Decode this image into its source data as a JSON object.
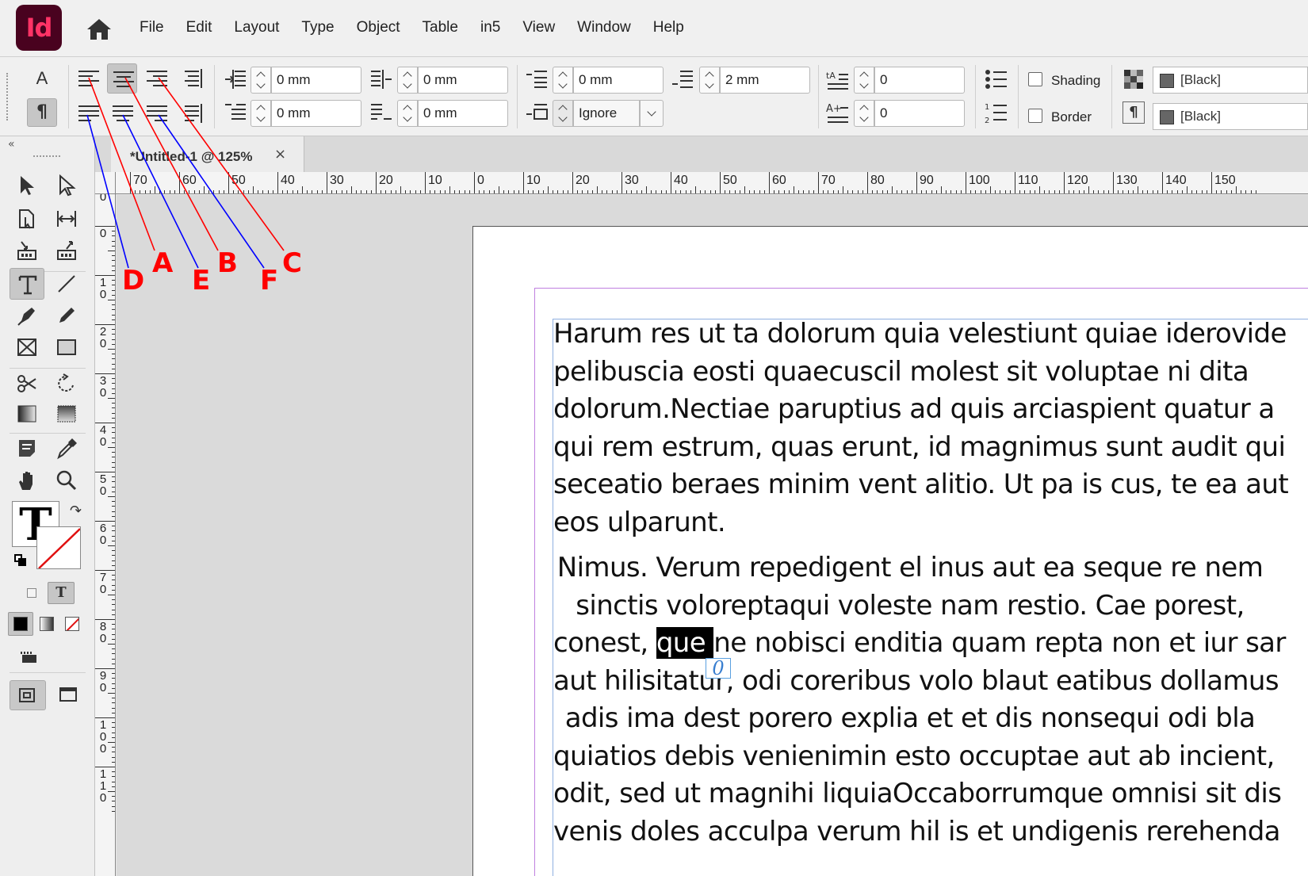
{
  "app": {
    "logo_text": "Id",
    "brand_color": "#49021f",
    "accent_color": "#ff3366"
  },
  "menu": [
    "File",
    "Edit",
    "Layout",
    "Type",
    "Object",
    "Table",
    "in5",
    "View",
    "Window",
    "Help"
  ],
  "control": {
    "left_indent": "0 mm",
    "right_indent": "0 mm",
    "first_line_indent": "0 mm",
    "last_line_indent": "0 mm",
    "space_before": "0 mm",
    "space_after": "2 mm",
    "align_to_grid": "Ignore",
    "drop_cap_lines": "0",
    "drop_cap_chars": "0",
    "shading_label": "Shading",
    "border_label": "Border",
    "shading_color": "[Black]",
    "border_color": "[Black]"
  },
  "tab": {
    "title": "*Untitled-1 @ 125%",
    "close": "×"
  },
  "rulers": {
    "horizontal": [
      "70",
      "60",
      "50",
      "40",
      "30",
      "20",
      "10",
      "0",
      "10",
      "20",
      "30",
      "40",
      "50",
      "60",
      "70",
      "80",
      "90",
      "100",
      "110",
      "120",
      "130",
      "140",
      "150"
    ],
    "vertical_top": "0",
    "vertical": [
      "0",
      "10",
      "20",
      "30",
      "40",
      "50",
      "60",
      "70",
      "80",
      "90",
      "100",
      "110"
    ]
  },
  "document": {
    "paragraph1": [
      "Harum res ut ta dolorum quia velestiunt quiae iderovide",
      "pelibuscia eosti quaecuscil molest sit voluptae ni dita",
      "dolorum.Nectiae paruptius ad quis arciaspient quatur a",
      "qui rem estrum, quas erunt, id magnimus sunt audit qui",
      "seceatio beraes minim vent alitio. Ut pa is cus, te ea aut",
      "eos ulparunt."
    ],
    "paragraph2": {
      "line1": "Nimus. Verum repedigent el inus aut ea seque re nem",
      "line2": "sinctis voloreptaqui voleste nam restio. Cae porest,",
      "line3_before": "conest, ",
      "line3_selected": "que ",
      "line3_after": "ne nobisci enditia quam repta non et iur sar",
      "line4": "aut hilisitatur, odi coreribus volo blaut eatibus dollamus",
      "line5": "adis ima dest porero explia et et dis nonsequi odi bla",
      "line6": "quiatios debis venienimin esto occuptae aut ab incient,",
      "line7": "odit, sed ut magnihi liquiaOccaborrumque omnisi sit dis",
      "line8": "venis doles acculpa verum hil is et undigenis rerehenda"
    },
    "overset_marker": "0"
  },
  "annotations": {
    "labels": [
      "A",
      "B",
      "C",
      "D",
      "E",
      "F"
    ],
    "colors": {
      "red": "#ff0000",
      "blue": "#0000ff"
    }
  }
}
